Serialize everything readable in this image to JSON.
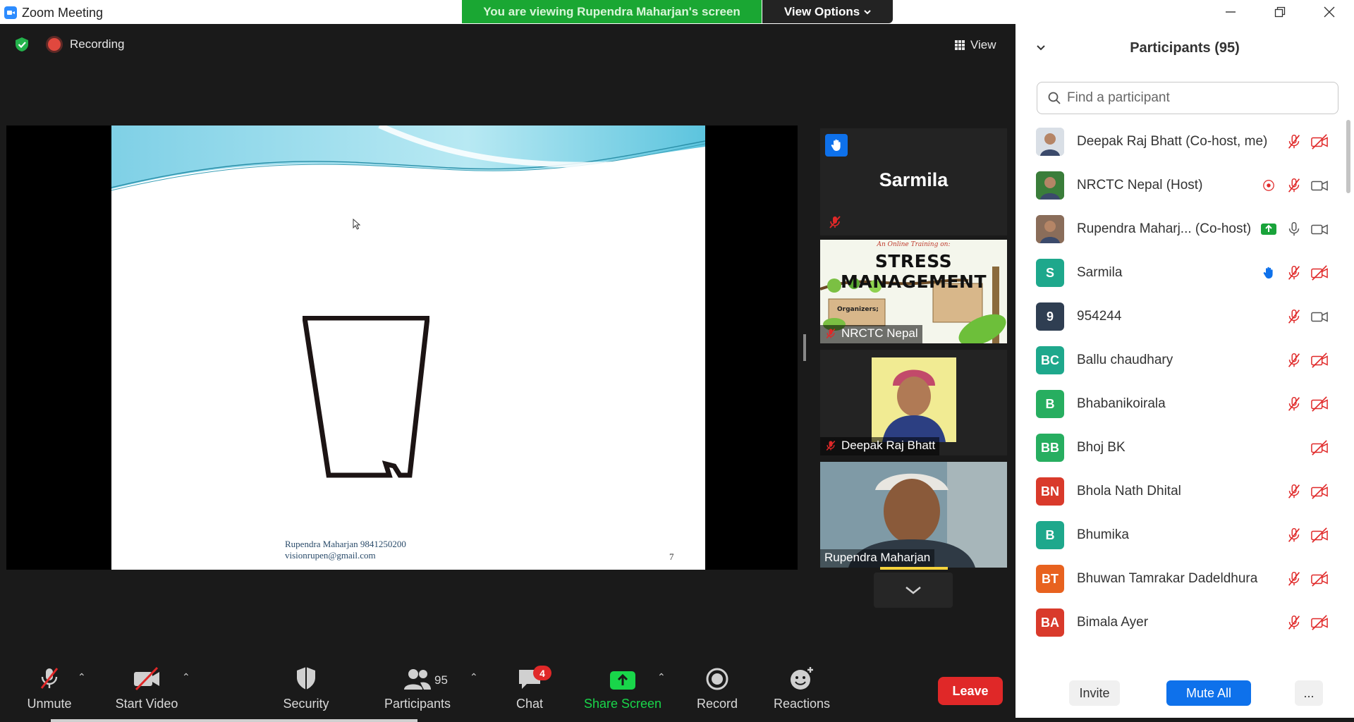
{
  "window": {
    "title": "Zoom Meeting",
    "banner_text": "You are viewing Rupendra Maharjan's screen",
    "view_options_label": "View Options"
  },
  "meeting": {
    "recording_label": "Recording",
    "view_label": "View",
    "slide": {
      "footer_line1": "Rupendra Maharjan 9841250200",
      "footer_line2": "visionrupen@gmail.com",
      "page_number": "7"
    },
    "tiles": {
      "sarmila_name": "Sarmila",
      "nrctc_label": "NRCTC Nepal",
      "nrctc_thumb_top": "An Online Training on:",
      "nrctc_thumb_title": "STRESS MANAGEMENT",
      "nrctc_thumb_organizers": "Organizers;",
      "deepak_label": "Deepak Raj Bhatt",
      "rupendra_label": "Rupendra Maharjan"
    }
  },
  "toolbar": {
    "unmute": "Unmute",
    "start_video": "Start Video",
    "security": "Security",
    "participants": "Participants",
    "participants_count": "95",
    "chat": "Chat",
    "chat_badge": "4",
    "share_screen": "Share Screen",
    "record": "Record",
    "reactions": "Reactions",
    "leave": "Leave"
  },
  "panel": {
    "title": "Participants (95)",
    "search_placeholder": "Find a participant",
    "participants": [
      {
        "initials": "",
        "name": "Deepak Raj Bhatt (Co-host, me)",
        "avatar_color": "#d9dfe6",
        "photo": true,
        "icons": [
          "mic-muted",
          "video-off"
        ]
      },
      {
        "initials": "",
        "name": "NRCTC Nepal (Host)",
        "avatar_color": "#3a7d3a",
        "photo": true,
        "icons": [
          "record",
          "mic-muted",
          "video-on"
        ]
      },
      {
        "initials": "",
        "name": "Rupendra Maharj... (Co-host)",
        "avatar_color": "#8a6d5a",
        "photo": true,
        "icons": [
          "share",
          "mic-on",
          "video-on"
        ]
      },
      {
        "initials": "S",
        "name": "Sarmila",
        "avatar_color": "#1ea88c",
        "photo": false,
        "icons": [
          "raised-hand",
          "mic-muted",
          "video-off"
        ]
      },
      {
        "initials": "9",
        "name": "954244",
        "avatar_color": "#2f3e52",
        "photo": false,
        "icons": [
          "mic-muted",
          "video-on"
        ]
      },
      {
        "initials": "BC",
        "name": "Ballu chaudhary",
        "avatar_color": "#1ea88c",
        "photo": false,
        "icons": [
          "mic-muted",
          "video-off"
        ]
      },
      {
        "initials": "B",
        "name": "Bhabanikoirala",
        "avatar_color": "#27ae60",
        "photo": false,
        "icons": [
          "mic-muted",
          "video-off"
        ]
      },
      {
        "initials": "BB",
        "name": "Bhoj BK",
        "avatar_color": "#27ae60",
        "photo": false,
        "icons": [
          "video-off"
        ]
      },
      {
        "initials": "BN",
        "name": "Bhola Nath Dhital",
        "avatar_color": "#d93a2b",
        "photo": false,
        "icons": [
          "mic-muted",
          "video-off"
        ]
      },
      {
        "initials": "B",
        "name": "Bhumika",
        "avatar_color": "#1ea88c",
        "photo": false,
        "icons": [
          "mic-muted",
          "video-off"
        ]
      },
      {
        "initials": "BT",
        "name": "Bhuwan Tamrakar Dadeldhura",
        "avatar_color": "#e8621f",
        "photo": false,
        "icons": [
          "mic-muted",
          "video-off"
        ]
      },
      {
        "initials": "BA",
        "name": "Bimala Ayer",
        "avatar_color": "#d93a2b",
        "photo": false,
        "icons": [
          "mic-muted",
          "video-off"
        ]
      }
    ],
    "invite": "Invite",
    "mute_all": "Mute All",
    "more": "..."
  }
}
